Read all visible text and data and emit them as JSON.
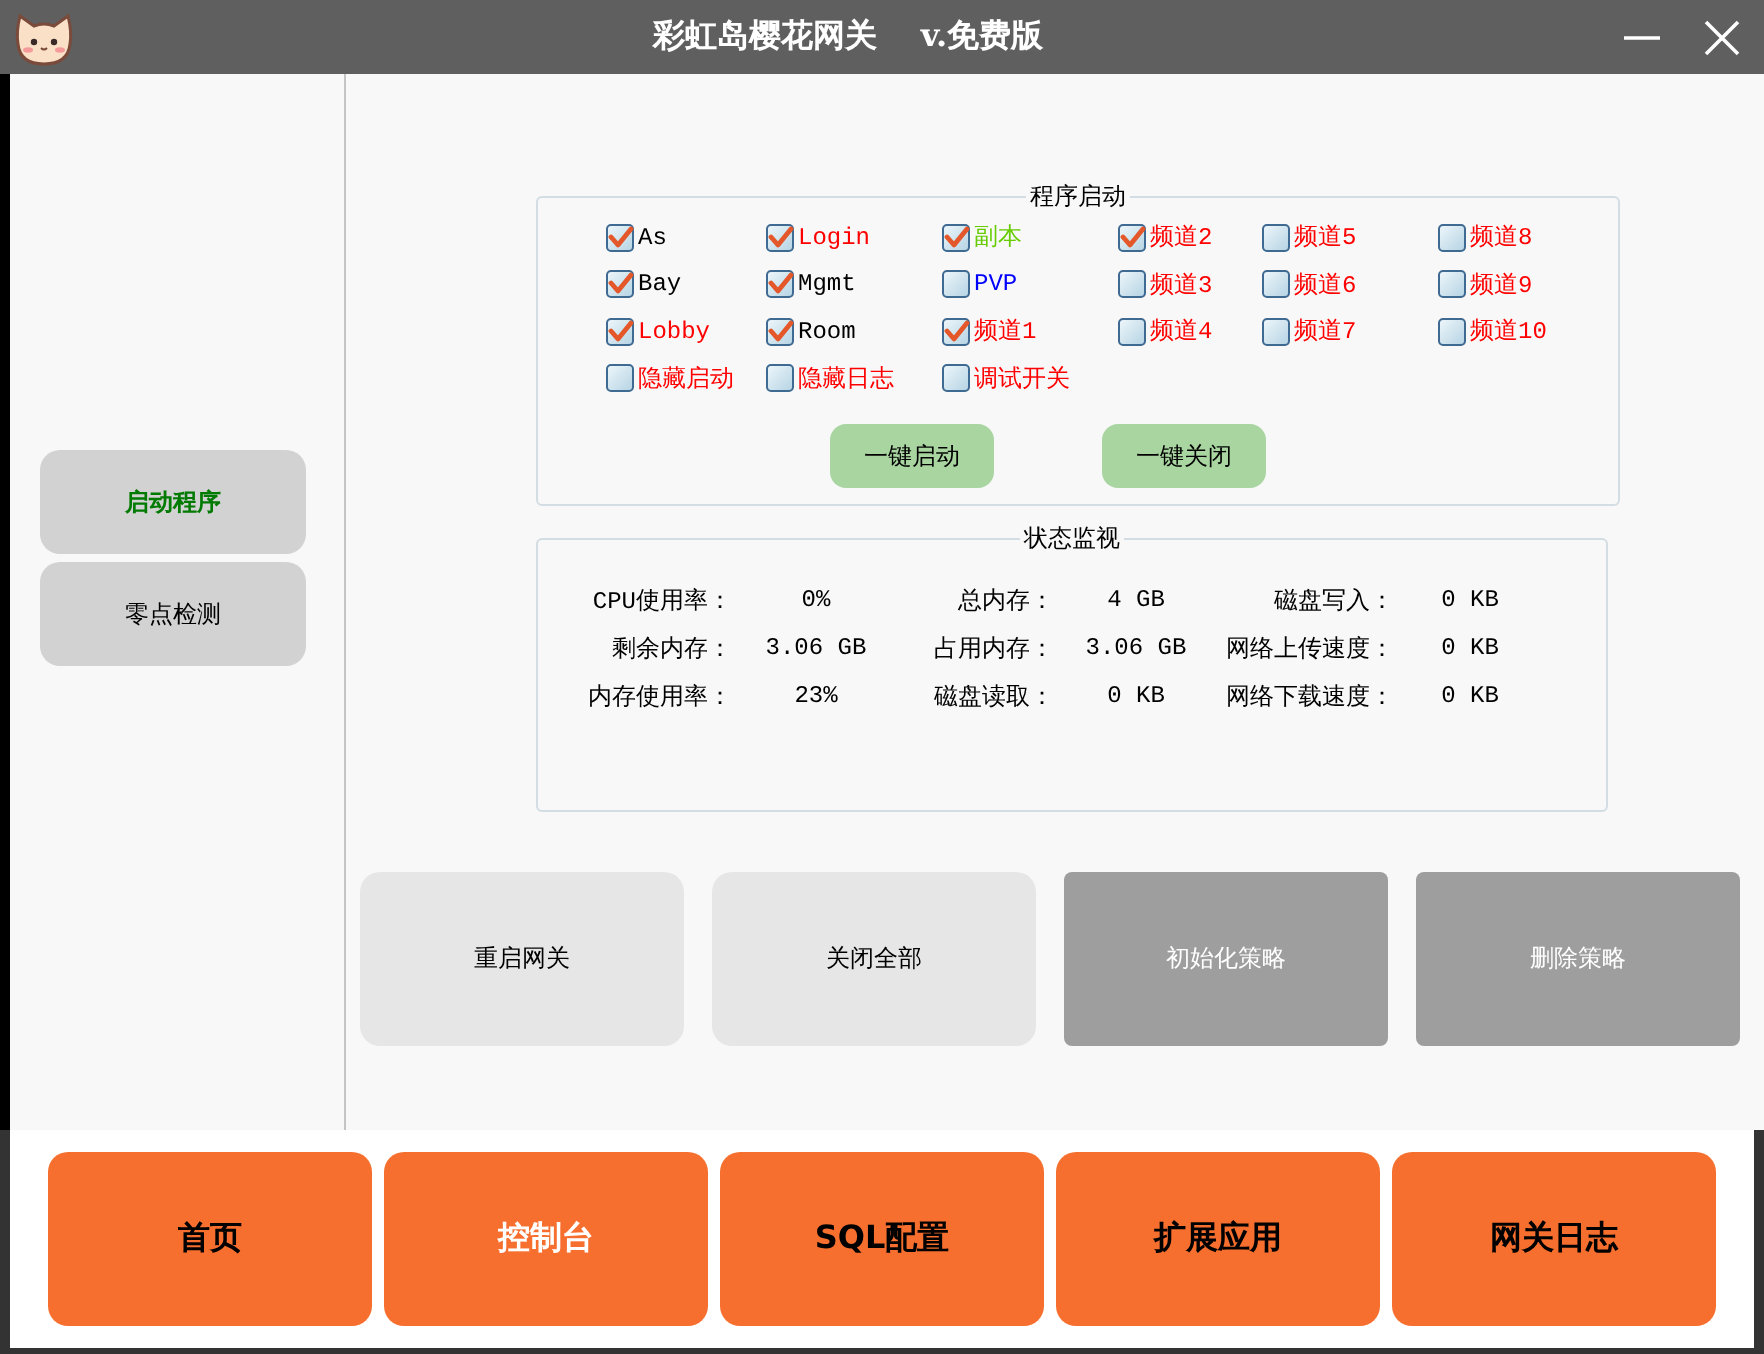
{
  "window": {
    "title": "彩虹岛樱花网关",
    "edition": "v.免费版"
  },
  "sidebar": {
    "items": [
      {
        "label": "启动程序",
        "selected": true
      },
      {
        "label": "零点检测",
        "selected": false
      }
    ]
  },
  "program_launch": {
    "title": "程序启动",
    "options": [
      {
        "label": "As",
        "checked": true,
        "color": "#000000"
      },
      {
        "label": "Login",
        "checked": true,
        "color": "#ff0000"
      },
      {
        "label": "副本",
        "checked": true,
        "color": "#66cc00"
      },
      {
        "label": "频道2",
        "checked": true,
        "color": "#ff0000"
      },
      {
        "label": "频道5",
        "checked": false,
        "color": "#ff0000"
      },
      {
        "label": "频道8",
        "checked": false,
        "color": "#ff0000"
      },
      {
        "label": "Bay",
        "checked": true,
        "color": "#000000"
      },
      {
        "label": "Mgmt",
        "checked": true,
        "color": "#000000"
      },
      {
        "label": "PVP",
        "checked": false,
        "color": "#0000ff"
      },
      {
        "label": "频道3",
        "checked": false,
        "color": "#ff0000"
      },
      {
        "label": "频道6",
        "checked": false,
        "color": "#ff0000"
      },
      {
        "label": "频道9",
        "checked": false,
        "color": "#ff0000"
      },
      {
        "label": "Lobby",
        "checked": true,
        "color": "#ff0000"
      },
      {
        "label": "Room",
        "checked": true,
        "color": "#000000"
      },
      {
        "label": "频道1",
        "checked": true,
        "color": "#ff0000"
      },
      {
        "label": "频道4",
        "checked": false,
        "color": "#ff0000"
      },
      {
        "label": "频道7",
        "checked": false,
        "color": "#ff0000"
      },
      {
        "label": "频道10",
        "checked": false,
        "color": "#ff0000"
      },
      {
        "label": "隐藏启动",
        "checked": false,
        "color": "#ff0000"
      },
      {
        "label": "隐藏日志",
        "checked": false,
        "color": "#ff0000"
      },
      {
        "label": "调试开关",
        "checked": false,
        "color": "#ff0000"
      }
    ],
    "buttons": [
      "一键启动",
      "一键关闭"
    ]
  },
  "status_monitor": {
    "title": "状态监视",
    "items": [
      {
        "label": "CPU使用率：",
        "value": "0%"
      },
      {
        "label": "总内存：",
        "value": "4 GB"
      },
      {
        "label": "磁盘写入：",
        "value": "0 KB"
      },
      {
        "label": "剩余内存：",
        "value": "3.06 GB"
      },
      {
        "label": "占用内存：",
        "value": "3.06 GB"
      },
      {
        "label": "网络上传速度：",
        "value": "0 KB"
      },
      {
        "label": "内存使用率：",
        "value": "23%"
      },
      {
        "label": "磁盘读取：",
        "value": "0 KB"
      },
      {
        "label": "网络下载速度：",
        "value": "0 KB"
      }
    ]
  },
  "actions": [
    {
      "label": "重启网关",
      "disabled": false
    },
    {
      "label": "关闭全部",
      "disabled": false
    },
    {
      "label": "初始化策略",
      "disabled": true
    },
    {
      "label": "删除策略",
      "disabled": true
    }
  ],
  "nav": [
    {
      "label": "首页",
      "selected": false
    },
    {
      "label": "控制台",
      "selected": true
    },
    {
      "label": "SQL配置",
      "selected": false
    },
    {
      "label": "扩展应用",
      "selected": false
    },
    {
      "label": "网关日志",
      "selected": false
    }
  ]
}
